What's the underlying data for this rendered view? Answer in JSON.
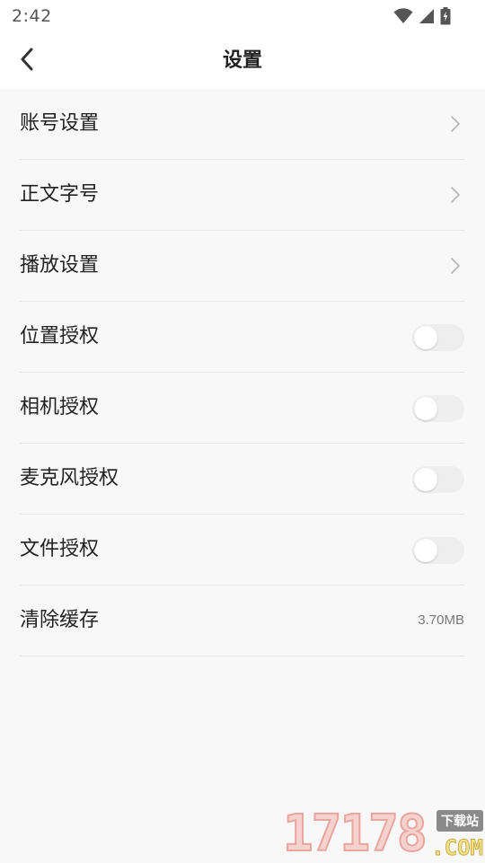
{
  "status_bar": {
    "time": "2:42",
    "icons": [
      "wifi-icon",
      "cell-signal-icon",
      "battery-charging-icon"
    ]
  },
  "header": {
    "back_icon": "chevron-left-icon",
    "title": "设置"
  },
  "settings": {
    "items": [
      {
        "label": "账号设置",
        "control": "chevron"
      },
      {
        "label": "正文字号",
        "control": "chevron"
      },
      {
        "label": "播放设置",
        "control": "chevron"
      },
      {
        "label": "位置授权",
        "control": "toggle",
        "checked": false
      },
      {
        "label": "相机授权",
        "control": "toggle",
        "checked": false
      },
      {
        "label": "麦克风授权",
        "control": "toggle",
        "checked": false
      },
      {
        "label": "文件授权",
        "control": "toggle",
        "checked": false
      },
      {
        "label": "清除缓存",
        "control": "value",
        "value": "3.70MB"
      }
    ]
  },
  "watermark": {
    "number": "17178",
    "tag": "下载站",
    "domain": ".COM"
  },
  "colors": {
    "background": "#f8f8f8",
    "header_background": "#ffffff",
    "divider": "#e6e6e6",
    "toggle_off": "#eeeeee",
    "secondary_text": "#777777"
  }
}
